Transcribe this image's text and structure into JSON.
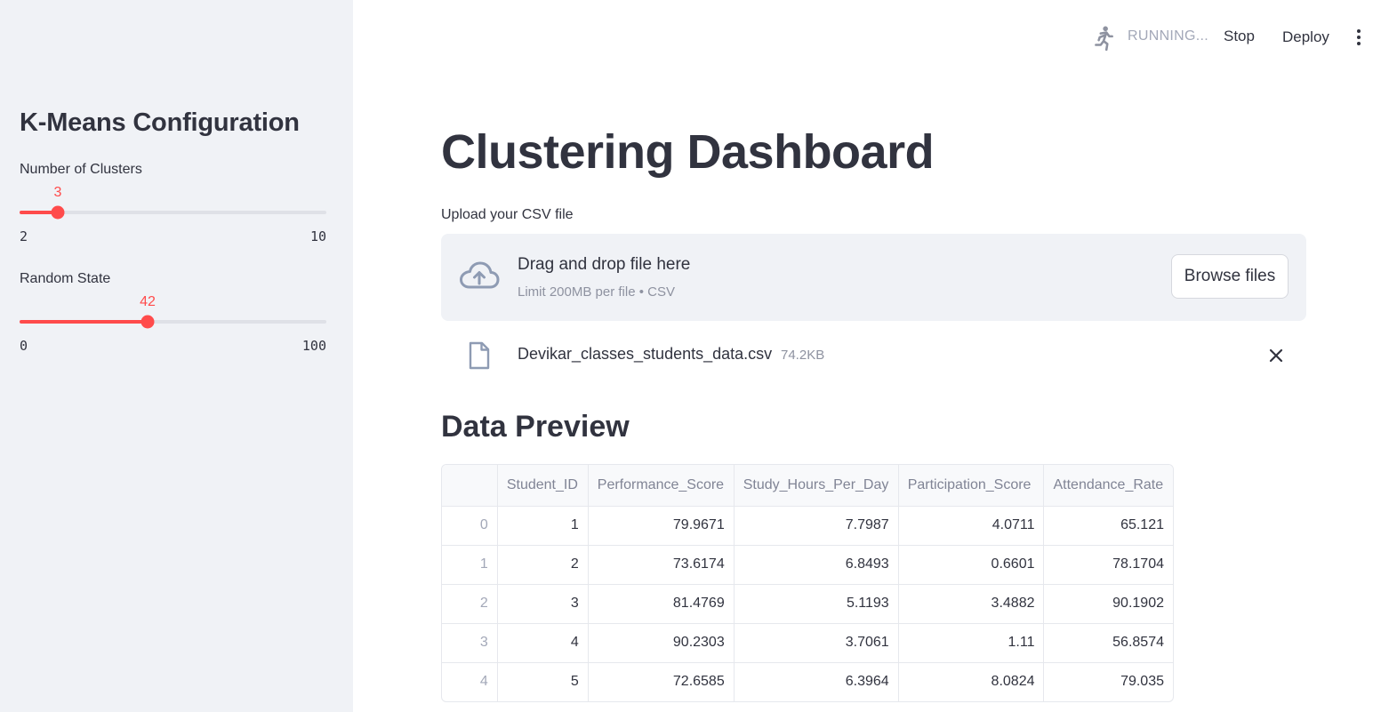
{
  "sidebar": {
    "title": "K-Means Configuration",
    "clusters": {
      "label": "Number of Clusters",
      "value": "3",
      "min": "2",
      "max": "10"
    },
    "random_state": {
      "label": "Random State",
      "value": "42",
      "min": "0",
      "max": "100"
    }
  },
  "header": {
    "status": "RUNNING...",
    "stop_label": "Stop",
    "deploy_label": "Deploy",
    "icons": {
      "running": "running-man-icon",
      "menu": "more-vertical-icon"
    }
  },
  "main": {
    "title": "Clustering Dashboard",
    "uploader": {
      "label": "Upload your CSV file",
      "drop_title": "Drag and drop file here",
      "drop_sub": "Limit 200MB per file • CSV",
      "browse_label": "Browse files",
      "icon": "cloud-upload-icon"
    },
    "file": {
      "name": "Devikar_classes_students_data.csv",
      "size": "74.2KB",
      "icon": "file-icon",
      "remove_icon": "close-icon"
    },
    "preview": {
      "title": "Data Preview",
      "columns": [
        "",
        "Student_ID",
        "Performance_Score",
        "Study_Hours_Per_Day",
        "Participation_Score",
        "Attendance_Rate"
      ],
      "rows": [
        [
          "0",
          "1",
          "79.9671",
          "7.7987",
          "4.0711",
          "65.121"
        ],
        [
          "1",
          "2",
          "73.6174",
          "6.8493",
          "0.6601",
          "78.1704"
        ],
        [
          "2",
          "3",
          "81.4769",
          "5.1193",
          "3.4882",
          "90.1902"
        ],
        [
          "3",
          "4",
          "90.2303",
          "3.7061",
          "1.11",
          "56.8574"
        ],
        [
          "4",
          "5",
          "72.6585",
          "6.3964",
          "8.0824",
          "79.035"
        ]
      ]
    }
  },
  "colors": {
    "accent": "#ff4b4b",
    "sidebar_bg": "#f0f2f6",
    "text": "#31333f"
  }
}
